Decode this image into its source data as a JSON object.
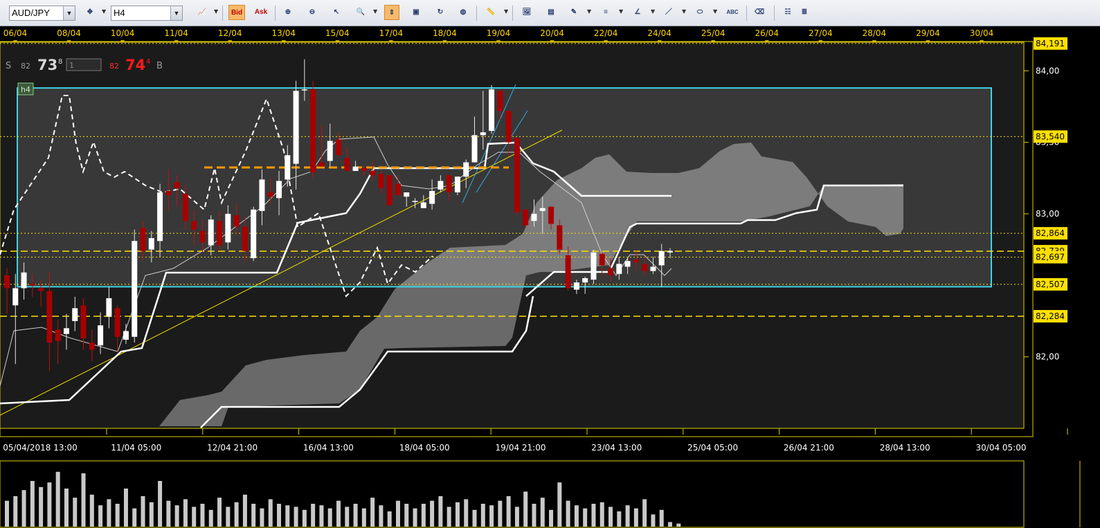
{
  "toolbar": {
    "symbol": "AUD/JPY",
    "timeframe": "H4",
    "bid_label": "Bid",
    "ask_label": "Ask",
    "abc_label": "ABC",
    "buttons": [
      {
        "name": "chart-type-icon",
        "x": 0
      },
      {
        "name": "bid-button"
      },
      {
        "name": "ask-button"
      }
    ]
  },
  "quote": {
    "sell_label": "S",
    "sell_small": "82",
    "sell_big": "73",
    "sell_sup": "8",
    "lot": "1",
    "buy_small": "82",
    "buy_big": "74",
    "buy_sup": "4",
    "buy_label": "B"
  },
  "timeframe_badge": "h4",
  "colors": {
    "background": "#000000",
    "plot": "#1c1c1c",
    "axis_text": "#ffffff",
    "date_text": "#ffd700",
    "up_candle": "#ffffff",
    "down_candle": "#a80000",
    "rectangle": "#3fd4e6",
    "level_line": "#ffe000",
    "resistance": "#ff9a00",
    "sell_quote": "#d8d8d8",
    "buy_quote": "#ff1a1a"
  },
  "chart_data": {
    "type": "candlestick",
    "symbol": "AUD/JPY",
    "timeframe": "H4",
    "top_dates": [
      "06/04",
      "08/04",
      "10/04",
      "11/04",
      "12/04",
      "13/04",
      "15/04",
      "17/04",
      "18/04",
      "19/04",
      "20/04",
      "22/04",
      "24/04",
      "25/04",
      "26/04",
      "27/04",
      "28/04",
      "29/04",
      "30/04"
    ],
    "bottom_dates": [
      "05/04/2018 13:00",
      "11/04 05:00",
      "12/04 21:00",
      "16/04 13:00",
      "18/04 05:00",
      "19/04 21:00",
      "23/04 13:00",
      "25/04 05:00",
      "26/04 21:00",
      "28/04 13:00",
      "30/04 05:00"
    ],
    "price_ticks": [
      "84,00",
      "83,50",
      "83,00",
      "82,00"
    ],
    "price_tick_values": [
      84.0,
      83.5,
      83.0,
      82.0
    ],
    "ylim": [
      81.5,
      84.2
    ],
    "highlight_levels": [
      {
        "label": "84,191",
        "value": 84.191,
        "style": "dotted"
      },
      {
        "label": "83,540",
        "value": 83.54,
        "style": "dotted"
      },
      {
        "label": "82,864",
        "value": 82.864,
        "style": "dotted"
      },
      {
        "label": "82,739",
        "value": 82.739,
        "style": "dashed"
      },
      {
        "label": "82,697",
        "value": 82.697,
        "style": "dotted"
      },
      {
        "label": "82,507",
        "value": 82.507,
        "style": "dotted"
      },
      {
        "label": "82,284",
        "value": 82.284,
        "style": "dashed"
      }
    ],
    "range_box": {
      "high": 83.88,
      "low": 82.49
    },
    "resistance_level": 83.38,
    "candles": [
      [
        82.57,
        82.48,
        82.62,
        82.3
      ],
      [
        82.36,
        82.48,
        82.58,
        81.95
      ],
      [
        82.48,
        82.59,
        82.66,
        82.4
      ],
      [
        82.51,
        82.5,
        82.58,
        82.42
      ],
      [
        82.48,
        82.46,
        82.54,
        82.35
      ],
      [
        82.46,
        82.1,
        82.59,
        81.9
      ],
      [
        82.19,
        82.11,
        82.26,
        81.95
      ],
      [
        82.16,
        82.2,
        82.3,
        82.05
      ],
      [
        82.25,
        82.34,
        82.42,
        82.18
      ],
      [
        82.36,
        82.13,
        82.41,
        82.05
      ],
      [
        82.1,
        82.05,
        82.19,
        81.97
      ],
      [
        82.08,
        82.22,
        82.31,
        82.02
      ],
      [
        82.28,
        82.41,
        82.49,
        82.2
      ],
      [
        82.34,
        82.14,
        82.36,
        82.03
      ],
      [
        82.12,
        82.18,
        82.23,
        82.09
      ],
      [
        82.14,
        82.81,
        82.89,
        82.1
      ],
      [
        82.9,
        82.74,
        82.95,
        82.67
      ],
      [
        82.75,
        82.83,
        82.88,
        82.66
      ],
      [
        82.81,
        83.15,
        83.21,
        82.7
      ],
      [
        83.16,
        83.13,
        83.31,
        83.02
      ],
      [
        83.22,
        83.18,
        83.27,
        83.05
      ],
      [
        83.14,
        82.95,
        83.2,
        82.89
      ],
      [
        82.95,
        82.89,
        83.03,
        82.78
      ],
      [
        82.88,
        82.8,
        82.96,
        82.73
      ],
      [
        82.78,
        82.96,
        82.99,
        82.71
      ],
      [
        82.95,
        82.78,
        83.02,
        82.74
      ],
      [
        82.8,
        83.0,
        83.06,
        82.75
      ],
      [
        82.99,
        82.91,
        83.07,
        82.85
      ],
      [
        82.91,
        82.74,
        82.98,
        82.66
      ],
      [
        82.69,
        83.03,
        83.05,
        82.67
      ],
      [
        83.02,
        83.24,
        83.31,
        82.92
      ],
      [
        83.15,
        83.12,
        83.25,
        83.07
      ],
      [
        83.11,
        83.23,
        83.3,
        82.99
      ],
      [
        83.24,
        83.41,
        83.48,
        83.19
      ],
      [
        83.35,
        83.86,
        83.93,
        83.17
      ],
      [
        83.87,
        83.87,
        84.08,
        83.79
      ],
      [
        83.87,
        83.29,
        83.93,
        83.25
      ],
      [
        83.36,
        83.33,
        83.62,
        83.34
      ],
      [
        83.37,
        83.51,
        83.63,
        83.33
      ],
      [
        83.52,
        83.41,
        83.57,
        83.41
      ],
      [
        83.39,
        83.3,
        83.47,
        83.34
      ],
      [
        83.3,
        83.33,
        83.37,
        83.3
      ],
      [
        83.32,
        83.3,
        83.34,
        83.26
      ],
      [
        83.3,
        83.27,
        83.37,
        83.24
      ],
      [
        83.28,
        83.18,
        83.3,
        83.14
      ],
      [
        83.27,
        83.06,
        83.23,
        83.11
      ],
      [
        83.21,
        83.13,
        83.27,
        83.13
      ],
      [
        83.12,
        83.15,
        83.14,
        83.05
      ],
      [
        83.09,
        83.09,
        83.11,
        83.04
      ],
      [
        83.04,
        83.08,
        83.13,
        83.05
      ],
      [
        83.07,
        83.16,
        83.24,
        83.03
      ],
      [
        83.17,
        83.23,
        83.27,
        83.15
      ],
      [
        83.27,
        83.15,
        83.26,
        83.09
      ],
      [
        83.15,
        83.26,
        83.26,
        83.13
      ],
      [
        83.26,
        83.36,
        83.38,
        83.18
      ],
      [
        83.36,
        83.55,
        83.68,
        83.36
      ],
      [
        83.55,
        83.57,
        83.86,
        83.45
      ],
      [
        83.58,
        83.87,
        83.9,
        83.56
      ],
      [
        83.86,
        83.72,
        83.87,
        83.66
      ],
      [
        83.72,
        83.5,
        83.61,
        83.4
      ],
      [
        83.53,
        83.01,
        83.51,
        82.99
      ],
      [
        83.03,
        82.92,
        83.02,
        82.9
      ],
      [
        82.95,
        83.0,
        83.1,
        82.91
      ],
      [
        83.02,
        83.04,
        83.12,
        82.86
      ],
      [
        83.05,
        82.93,
        83.05,
        82.89
      ],
      [
        82.92,
        82.75,
        82.96,
        82.72
      ],
      [
        82.71,
        82.48,
        82.77,
        82.46
      ],
      [
        82.47,
        82.52,
        82.54,
        82.44
      ],
      [
        82.52,
        82.55,
        82.56,
        82.44
      ],
      [
        82.54,
        82.73,
        82.75,
        82.51
      ],
      [
        82.72,
        82.64,
        82.73,
        82.56
      ],
      [
        82.62,
        82.57,
        82.69,
        82.53
      ],
      [
        82.58,
        82.65,
        82.7,
        82.54
      ],
      [
        82.63,
        82.67,
        82.69,
        82.58
      ],
      [
        82.68,
        82.66,
        82.74,
        82.6
      ],
      [
        82.65,
        82.6,
        82.7,
        82.57
      ],
      [
        82.6,
        82.63,
        82.7,
        82.58
      ],
      [
        82.64,
        82.74,
        82.79,
        82.49
      ],
      [
        82.73,
        82.74,
        82.76,
        82.69
      ]
    ],
    "volume": [
      34,
      40,
      48,
      60,
      52,
      58,
      72,
      50,
      38,
      70,
      42,
      28,
      36,
      30,
      50,
      24,
      40,
      32,
      60,
      34,
      28,
      36,
      26,
      30,
      22,
      38,
      26,
      32,
      42,
      30,
      24,
      36,
      30,
      28,
      26,
      22,
      30,
      28,
      24,
      34,
      26,
      30,
      24,
      38,
      28,
      20,
      34,
      30,
      24,
      30,
      34,
      40,
      26,
      32,
      36,
      22,
      30,
      28,
      34,
      40,
      26,
      46,
      30,
      38,
      22,
      58,
      34,
      28,
      24,
      30,
      32,
      26,
      20,
      28,
      24,
      36,
      16,
      22,
      6,
      4
    ]
  }
}
